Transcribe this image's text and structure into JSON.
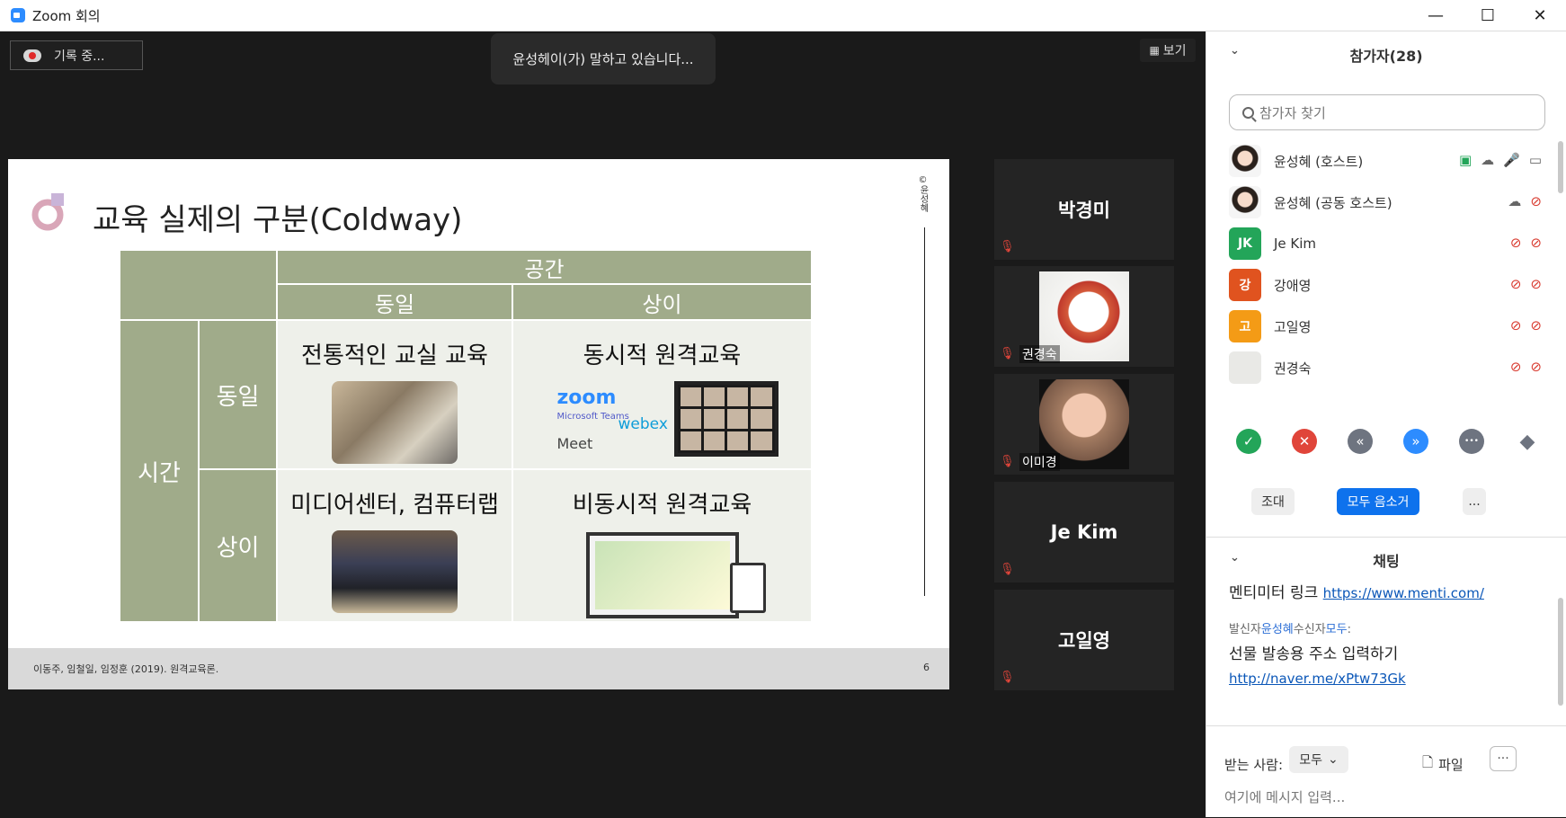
{
  "window": {
    "title": "Zoom 회의",
    "controls": [
      "minimize",
      "maximize",
      "close"
    ]
  },
  "meeting": {
    "recording_label": "기록 중...",
    "speaking_banner": "윤성헤이(가) 말하고 있습니다...",
    "view_button": "보기"
  },
  "slide": {
    "title": "교육 실제의 구분(Coldway)",
    "copyright": "©윤성혜",
    "footer_citation": "이동주, 임철일, 임정훈 (2019). 원격교육론.",
    "page_number": "6",
    "table": {
      "space_header": "공간",
      "space_same": "동일",
      "space_diff": "상이",
      "time_header": "시간",
      "time_same": "동일",
      "time_diff": "상이",
      "cell_same_same": "전통적인 교실 교육",
      "cell_same_diff": "동시적 원격교육",
      "cell_diff_same": "미디어센터, 컴퓨터랩",
      "cell_diff_diff": "비동시적 원격교육",
      "apps": {
        "zoom": "zoom",
        "teams": "Microsoft Teams",
        "meet": "Meet",
        "webex": "webex"
      }
    }
  },
  "tiles": [
    {
      "name": "박경미",
      "type": "name",
      "muted": true
    },
    {
      "name": "권경숙",
      "type": "photo-cup",
      "muted": true
    },
    {
      "name": "이미경",
      "type": "photo-avatar",
      "muted": true
    },
    {
      "name": "Je Kim",
      "type": "name",
      "muted": true
    },
    {
      "name": "고일영",
      "type": "name",
      "muted": true
    }
  ],
  "panel": {
    "participants_title": "참가자(28)",
    "search_placeholder": "참가자 찾기",
    "participants": [
      {
        "name": "윤성혜 (호스트)",
        "avatar": "face",
        "avatar_color": "#f5f5f5",
        "initials": ""
      },
      {
        "name": "윤성혜 (공동 호스트)",
        "avatar": "face",
        "avatar_color": "#f5f5f5",
        "initials": ""
      },
      {
        "name": "Je Kim",
        "avatar": "initials",
        "avatar_color": "#23a559",
        "initials": "JK"
      },
      {
        "name": "강애영",
        "avatar": "initials",
        "avatar_color": "#e0531f",
        "initials": "강"
      },
      {
        "name": "고일영",
        "avatar": "initials",
        "avatar_color": "#f49b16",
        "initials": "고"
      },
      {
        "name": "권경숙",
        "avatar": "photo",
        "avatar_color": "#e9e9e6",
        "initials": ""
      }
    ],
    "reactions": [
      {
        "name": "yes",
        "color": "#23a559",
        "glyph": "✓"
      },
      {
        "name": "no",
        "color": "#e0453a",
        "glyph": "✕"
      },
      {
        "name": "slower",
        "color": "#6e7480",
        "glyph": "«"
      },
      {
        "name": "faster",
        "color": "#2d8cff",
        "glyph": "»"
      },
      {
        "name": "more",
        "color": "#6e7480",
        "glyph": "•••"
      },
      {
        "name": "clear",
        "color": "#6e7480",
        "glyph": "◆"
      }
    ],
    "invite_button": "조대",
    "mute_all_button": "모두 음소거",
    "more_button": "...",
    "chat_title": "채팅",
    "chat": {
      "line1_text": "멘티미터 링크",
      "line1_link": "https://www.menti.com/",
      "meta_sender_prefix": "발신자",
      "meta_sender": "윤성혜",
      "meta_receiver_prefix": "수신자",
      "meta_receiver": "모두",
      "meta_suffix": ":",
      "message": "선물 발송용 주소 입력하기",
      "message_link": "http://naver.me/xPtw73Gk"
    },
    "to_label": "받는 사람:",
    "to_value": "모두",
    "file_label": "파일",
    "input_placeholder": "여기에 메시지 입력..."
  },
  "colors": {
    "zoom_blue": "#2d8cff",
    "slide_green": "#a0ab8a",
    "mute_red": "#e0453a"
  }
}
